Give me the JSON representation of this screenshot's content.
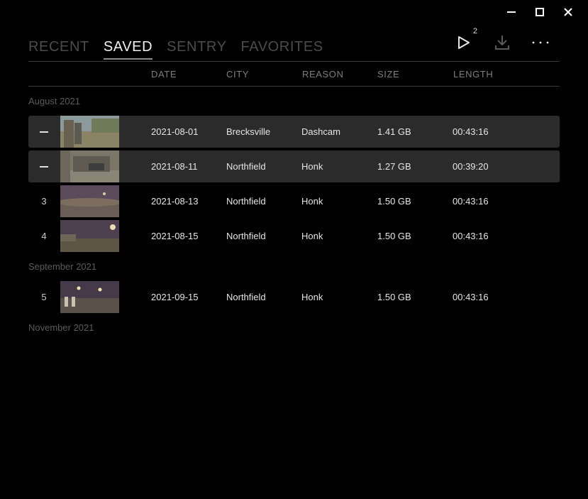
{
  "window_controls": {
    "minimize_icon": "minimize-icon",
    "maximize_icon": "maximize-icon",
    "close_icon": "close-icon"
  },
  "tabs": [
    {
      "label": "RECENT",
      "active": false
    },
    {
      "label": "SAVED",
      "active": true
    },
    {
      "label": "SENTRY",
      "active": false
    },
    {
      "label": "FAVORITES",
      "active": false
    }
  ],
  "toolbar": {
    "play_badge": "2",
    "play_icon": "play-icon",
    "download_icon": "download-icon",
    "more_icon": "more-icon"
  },
  "columns": {
    "date": "DATE",
    "city": "CITY",
    "reason": "REASON",
    "size": "SIZE",
    "length": "LENGTH"
  },
  "groups": [
    {
      "month": "August 2021",
      "rows": [
        {
          "index": "",
          "selected": true,
          "date": "2021-08-01",
          "city": "Brecksville",
          "reason": "Dashcam",
          "size": "1.41 GB",
          "length": "00:43:16",
          "thumb": "day"
        },
        {
          "index": "",
          "selected": true,
          "date": "2021-08-11",
          "city": "Northfield",
          "reason": "Honk",
          "size": "1.27 GB",
          "length": "00:39:20",
          "thumb": "garage"
        },
        {
          "index": "3",
          "selected": false,
          "date": "2021-08-13",
          "city": "Northfield",
          "reason": "Honk",
          "size": "1.50 GB",
          "length": "00:43:16",
          "thumb": "dusk"
        },
        {
          "index": "4",
          "selected": false,
          "date": "2021-08-15",
          "city": "Northfield",
          "reason": "Honk",
          "size": "1.50 GB",
          "length": "00:43:16",
          "thumb": "night"
        }
      ]
    },
    {
      "month": "September 2021",
      "rows": [
        {
          "index": "5",
          "selected": false,
          "date": "2021-09-15",
          "city": "Northfield",
          "reason": "Honk",
          "size": "1.50 GB",
          "length": "00:43:16",
          "thumb": "lot"
        }
      ]
    },
    {
      "month": "November 2021",
      "rows": []
    }
  ]
}
